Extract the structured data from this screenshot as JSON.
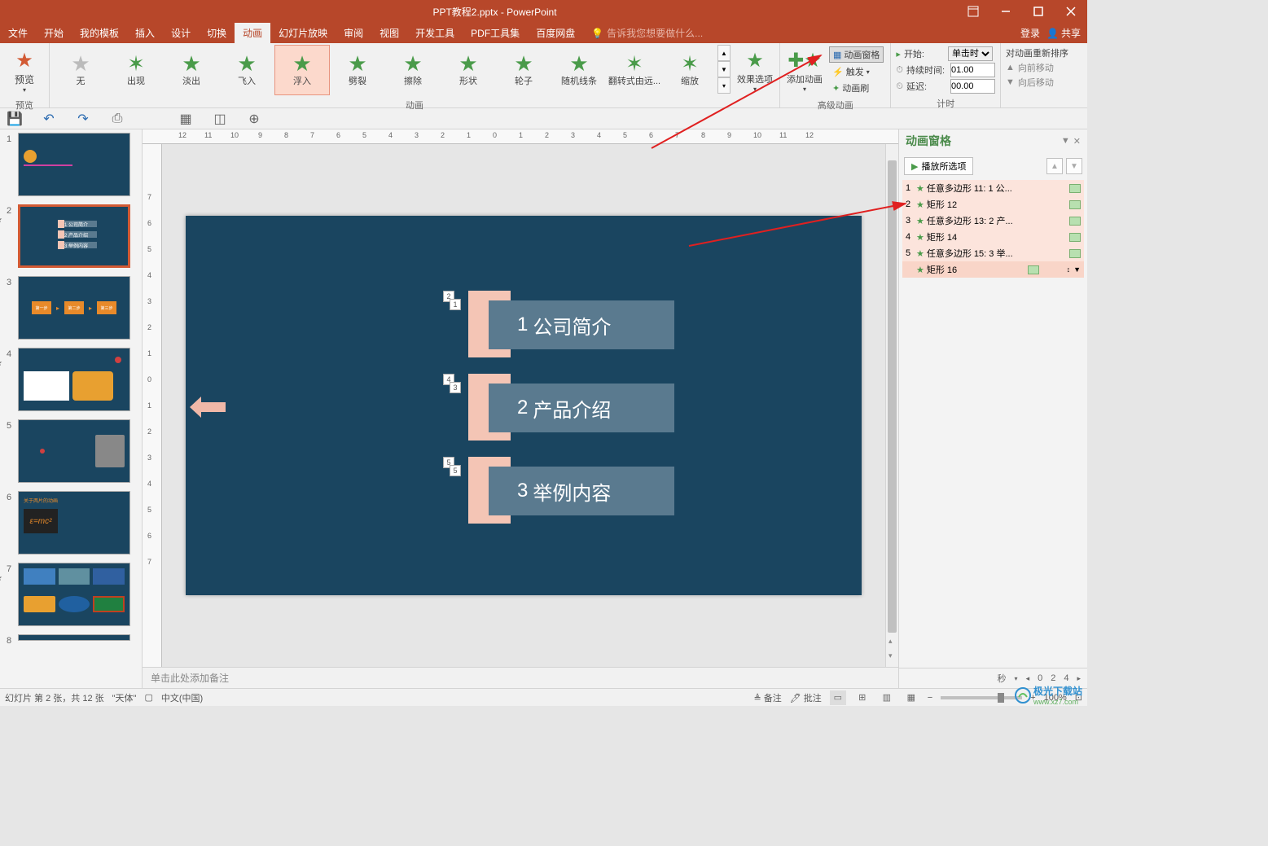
{
  "title": "PPT教程2.pptx - PowerPoint",
  "menu": {
    "file": "文件",
    "start": "开始",
    "template": "我的模板",
    "insert": "插入",
    "design": "设计",
    "transition": "切换",
    "anim": "动画",
    "slideshow": "幻灯片放映",
    "review": "审阅",
    "view": "视图",
    "dev": "开发工具",
    "pdf": "PDF工具集",
    "baidu": "百度网盘",
    "tellme": "告诉我您想要做什么...",
    "login": "登录",
    "share": "共享"
  },
  "ribbon": {
    "preview": "预览",
    "preview_grp": "预览",
    "anims": {
      "none": "无",
      "appear": "出现",
      "fade": "淡出",
      "flyin": "飞入",
      "floatin": "浮入",
      "split": "劈裂",
      "wipe": "擦除",
      "shape": "形状",
      "wheel": "轮子",
      "random": "随机线条",
      "fliprot": "翻转式由远...",
      "zoom": "缩放"
    },
    "anim_grp": "动画",
    "effect_opts": "效果选项",
    "add_anim": "添加动画",
    "adv": {
      "pane": "动画窗格",
      "trigger": "触发",
      "painter": "动画刷"
    },
    "adv_grp": "高级动画",
    "timing": {
      "start": "开始:",
      "start_val": "单击时",
      "duration": "持续时间:",
      "duration_val": "01.00",
      "delay": "延迟:",
      "delay_val": "00.00"
    },
    "timing_grp": "计时",
    "reorder": {
      "title": "对动画重新排序",
      "fwd": "向前移动",
      "back": "向后移动"
    }
  },
  "slide": {
    "toc1_num": "1",
    "toc1": "公司简介",
    "toc2_num": "2",
    "toc2": "产品介绍",
    "toc3_num": "3",
    "toc3": "举例内容",
    "tags": [
      "2",
      "1",
      "4",
      "3",
      "5",
      "5"
    ]
  },
  "anim_pane": {
    "title": "动画窗格",
    "play": "播放所选项",
    "items": [
      {
        "idx": "1",
        "name": "任意多边形 11: 1 公..."
      },
      {
        "idx": "2",
        "name": "矩形 12"
      },
      {
        "idx": "3",
        "name": "任意多边形 13: 2 产..."
      },
      {
        "idx": "4",
        "name": "矩形 14"
      },
      {
        "idx": "5",
        "name": "任意多边形 15: 3 举..."
      },
      {
        "idx": "",
        "name": "矩形 16"
      }
    ],
    "footer_sec": "秒",
    "footer_ticks": [
      "0",
      "2",
      "4"
    ]
  },
  "notes": "单击此处添加备注",
  "status": {
    "slide": "幻灯片 第 2 张，共 12 张",
    "theme": "\"天体\"",
    "lang": "中文(中国)",
    "notes": "备注",
    "comments": "批注",
    "zoom": "100%"
  },
  "thumbs": [
    "1",
    "2",
    "3",
    "4",
    "5",
    "6",
    "7",
    "8"
  ],
  "watermark": "极光下载站",
  "watermark_url": "www.xz7.com"
}
